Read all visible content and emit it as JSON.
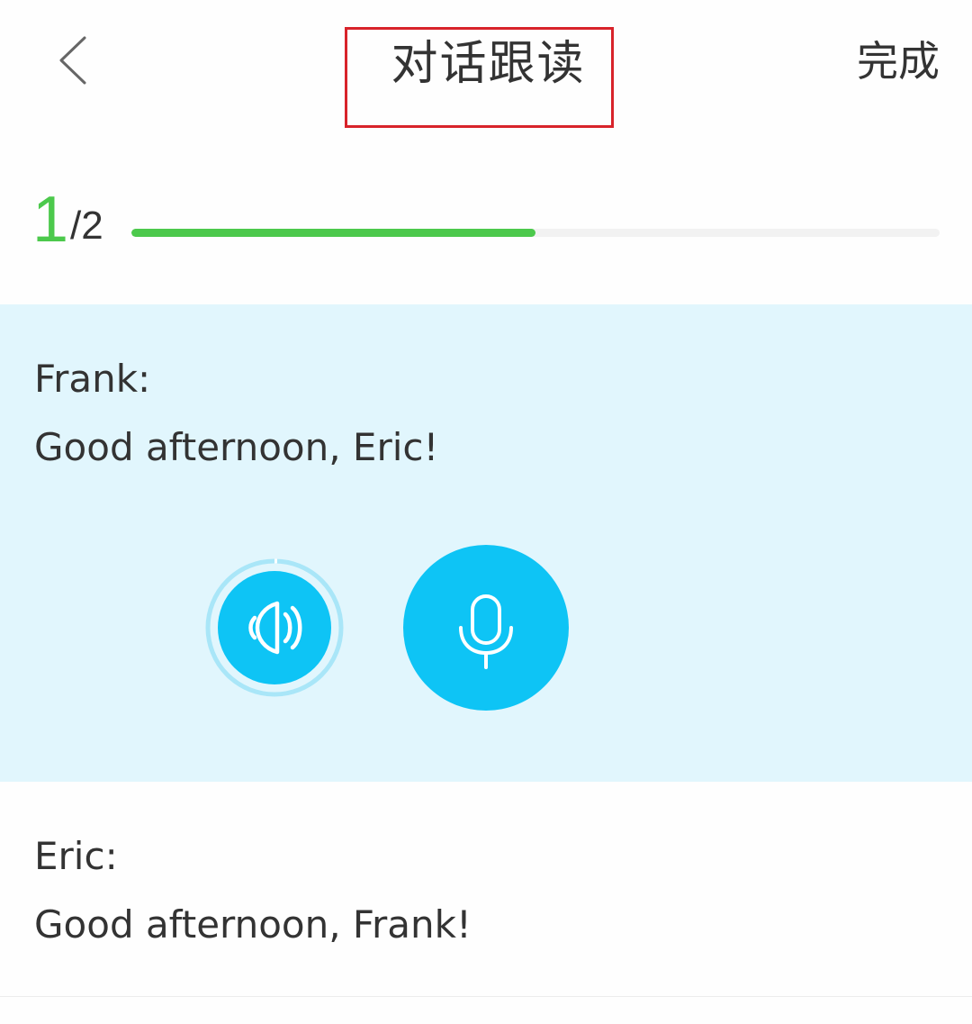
{
  "header": {
    "title": "对话跟读",
    "done_label": "完成",
    "back_icon": "chevron-left-icon"
  },
  "progress": {
    "current": "1",
    "separator_total": "/2",
    "fraction": 0.5,
    "fill_color": "#4cc94c"
  },
  "dialog": [
    {
      "speaker": "Frank:",
      "text": "Good afternoon, Eric!",
      "active": true
    },
    {
      "speaker": "Eric:",
      "text": "Good afternoon, Frank!",
      "active": false
    }
  ],
  "controls": {
    "play_icon": "speaker-play-icon",
    "record_icon": "microphone-icon",
    "accent_color": "#0ec4f5",
    "active_background": "#e1f6fd"
  }
}
